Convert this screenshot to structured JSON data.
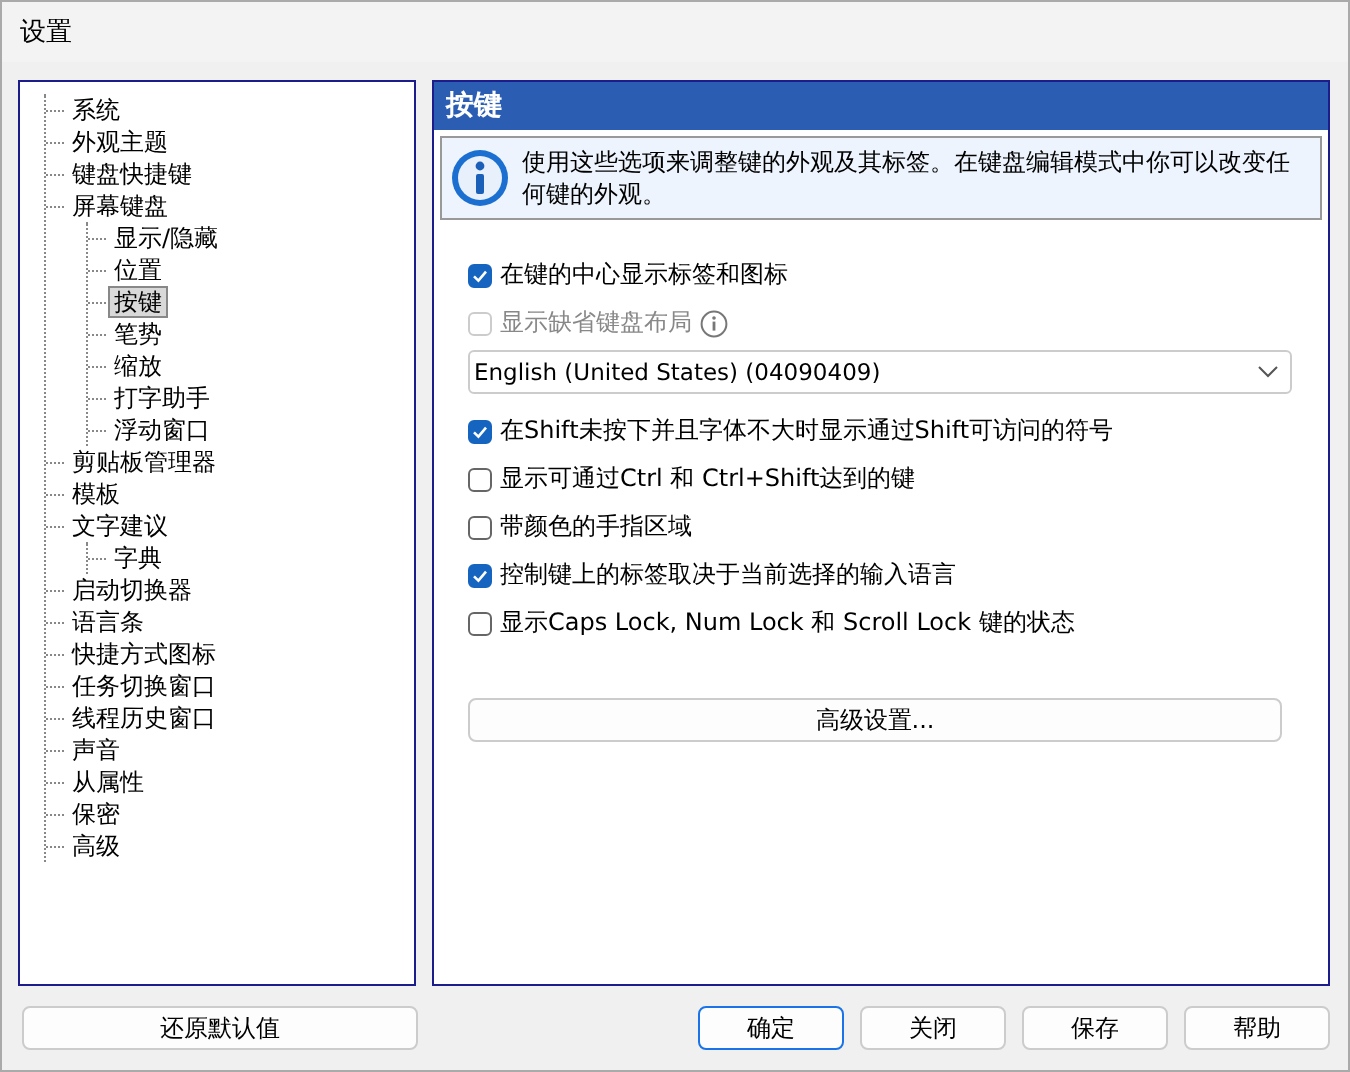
{
  "window": {
    "title": "设置"
  },
  "tree": [
    {
      "label": "系统",
      "selected": false
    },
    {
      "label": "外观主题",
      "selected": false
    },
    {
      "label": "键盘快捷键",
      "selected": false
    },
    {
      "label": "屏幕键盘",
      "selected": false,
      "children": [
        {
          "label": "显示/隐藏",
          "selected": false
        },
        {
          "label": "位置",
          "selected": false
        },
        {
          "label": "按键",
          "selected": true
        },
        {
          "label": "笔势",
          "selected": false
        },
        {
          "label": "缩放",
          "selected": false
        },
        {
          "label": "打字助手",
          "selected": false
        },
        {
          "label": "浮动窗口",
          "selected": false
        }
      ]
    },
    {
      "label": "剪贴板管理器",
      "selected": false
    },
    {
      "label": "模板",
      "selected": false
    },
    {
      "label": "文字建议",
      "selected": false,
      "children": [
        {
          "label": "字典",
          "selected": false
        }
      ]
    },
    {
      "label": "启动切换器",
      "selected": false
    },
    {
      "label": "语言条",
      "selected": false
    },
    {
      "label": "快捷方式图标",
      "selected": false
    },
    {
      "label": "任务切换窗口",
      "selected": false
    },
    {
      "label": "线程历史窗口",
      "selected": false
    },
    {
      "label": "声音",
      "selected": false
    },
    {
      "label": "从属性",
      "selected": false
    },
    {
      "label": "保密",
      "selected": false
    },
    {
      "label": "高级",
      "selected": false
    }
  ],
  "panel": {
    "title": "按键",
    "info": "使用这些选项来调整键的外观及其标签。在键盘编辑模式中你可以改变任何键的外观。",
    "options": [
      {
        "kind": "checkbox",
        "label": "在键的中心显示标签和图标",
        "checked": true,
        "disabled": false
      },
      {
        "kind": "checkbox",
        "label": "显示缺省键盘布局",
        "checked": false,
        "disabled": true,
        "info_icon": true
      },
      {
        "kind": "dropdown",
        "value": "English (United States) (04090409)"
      },
      {
        "kind": "checkbox",
        "label": "在Shift未按下并且字体不大时显示通过Shift可访问的符号",
        "checked": true,
        "disabled": false
      },
      {
        "kind": "checkbox",
        "label": "显示可通过Ctrl 和 Ctrl+Shift达到的键",
        "checked": false,
        "disabled": false
      },
      {
        "kind": "checkbox",
        "label": "带颜色的手指区域",
        "checked": false,
        "disabled": false
      },
      {
        "kind": "checkbox",
        "label": "控制键上的标签取决于当前选择的输入语言",
        "checked": true,
        "disabled": false
      },
      {
        "kind": "checkbox",
        "label": "显示Caps Lock, Num Lock 和 Scroll Lock 键的状态",
        "checked": false,
        "disabled": false
      }
    ],
    "advanced_button": "高级设置..."
  },
  "footer": {
    "reset_button": "还原默认值",
    "buttons": [
      {
        "label": "确定",
        "default": true
      },
      {
        "label": "关闭",
        "default": false
      },
      {
        "label": "保存",
        "default": false
      },
      {
        "label": "帮助",
        "default": false
      }
    ]
  }
}
